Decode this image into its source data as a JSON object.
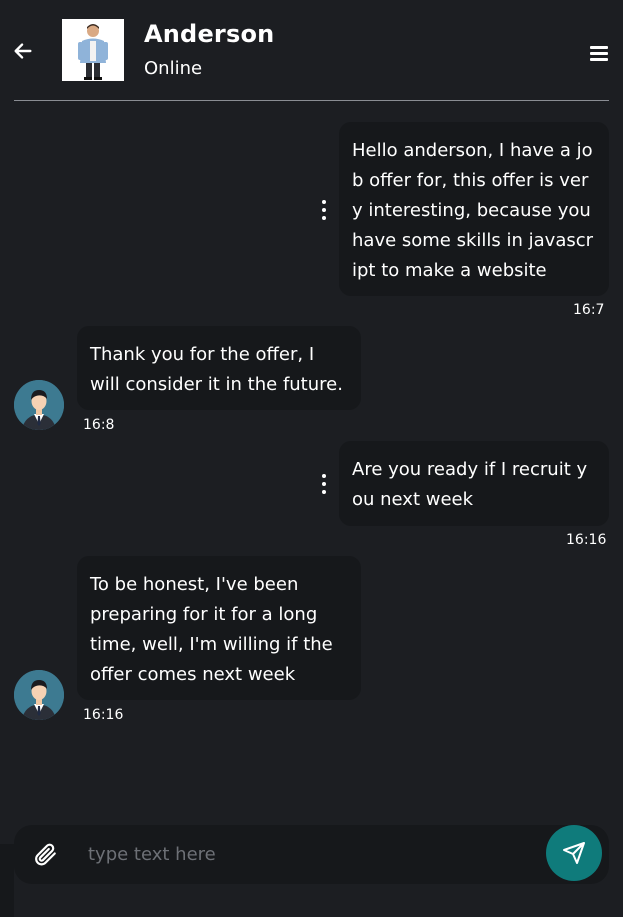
{
  "header": {
    "contact_name": "Anderson",
    "status": "Online"
  },
  "messages": [
    {
      "direction": "outgoing",
      "text": "Hello anderson, I have a job offer for, this offer is very interesting, because you have some skills in javascript to make a website",
      "time": "16:7"
    },
    {
      "direction": "incoming",
      "text": "Thank you for the offer, I will consider it in the future.",
      "time": "16:8"
    },
    {
      "direction": "outgoing",
      "text": "Are you ready if I recruit you next week",
      "time": "16:16"
    },
    {
      "direction": "incoming",
      "text": "To be honest, I've been preparing for it for a long time, well, I'm willing if the offer comes next week",
      "time": "16:16"
    }
  ],
  "composer": {
    "placeholder": "type text here",
    "value": ""
  },
  "icons": {
    "back": "arrow-left-icon",
    "menu": "hamburger-menu-icon",
    "message_options": "vertical-ellipsis-icon",
    "attach": "paperclip-icon",
    "send": "paper-plane-icon"
  },
  "colors": {
    "background": "#1c1e22",
    "bubble": "#16181b",
    "send_button": "#0f7b7b",
    "divider": "#8a8d93",
    "placeholder": "#6d7076"
  }
}
